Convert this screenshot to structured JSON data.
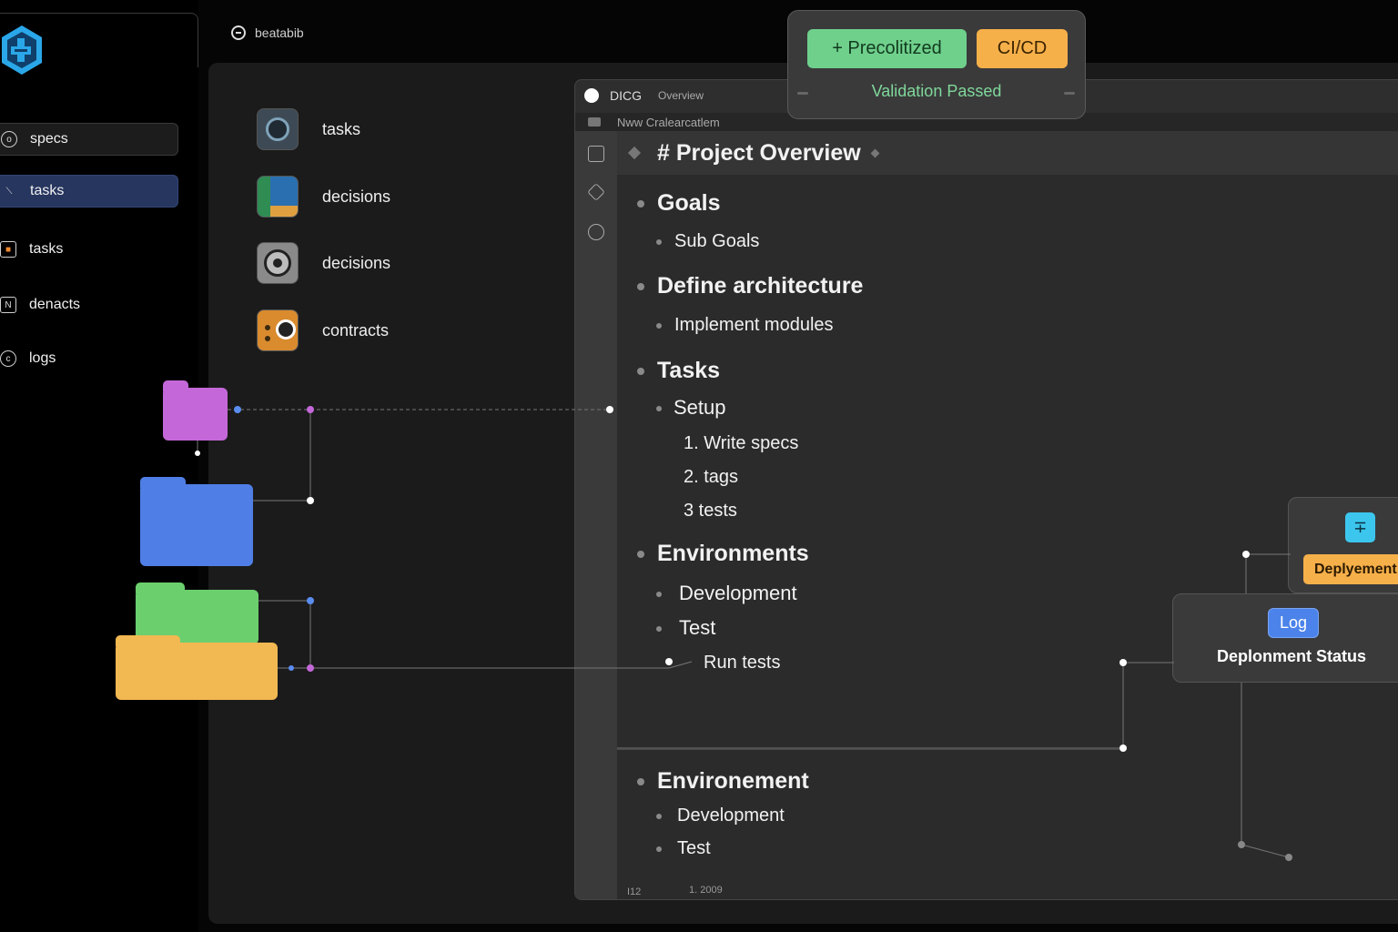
{
  "sidebar": {
    "items": [
      {
        "label": "specs",
        "icon": "circle-icon"
      },
      {
        "label": "tasks",
        "icon": "chart-icon"
      },
      {
        "label": "tasks",
        "icon": "orange-square-icon"
      },
      {
        "label": "denacts",
        "icon": "graph-icon"
      },
      {
        "label": "logs",
        "icon": "circle-icon"
      }
    ]
  },
  "top_tab": {
    "label": "beatabib"
  },
  "files": [
    {
      "label": "tasks",
      "icon": "camera-icon"
    },
    {
      "label": "decisions",
      "icon": "book-icon"
    },
    {
      "label": "decisions",
      "icon": "target-icon"
    },
    {
      "label": "contracts",
      "icon": "clock-icon"
    }
  ],
  "folder_colors": [
    "#c468d9",
    "#4f7fe6",
    "#6bcf6e",
    "#f2b851"
  ],
  "editor": {
    "title": "DICG",
    "breadcrumb": "Overview",
    "subtitle": "Nww Cralearcatlem",
    "heading": "# Project Overview",
    "sections": [
      {
        "title": "Goals",
        "items": [
          "Sub Goals"
        ]
      },
      {
        "title": "Define architecture",
        "items": [
          "Implement modules"
        ]
      },
      {
        "title": "Tasks",
        "sub": "Setup",
        "numbered": [
          "1.  Write specs",
          "2.  tags",
          "3   tests"
        ]
      },
      {
        "title": "Environments",
        "items": [
          "Development",
          "Test"
        ],
        "extra": "Run tests"
      },
      {
        "title": "Environement",
        "items": [
          "Development",
          "Test"
        ]
      }
    ],
    "footer_left": "I12",
    "footer_mid": "1. 2009"
  },
  "ci_popup": {
    "primary": "+  Precolitized",
    "secondary": "CI/CD",
    "status": "Validation Passed"
  },
  "deploy_card": {
    "icon": "plus-minus-icon",
    "label": "Deplyement"
  },
  "status_card": {
    "button": "Log",
    "title": "Deplonment Status"
  }
}
